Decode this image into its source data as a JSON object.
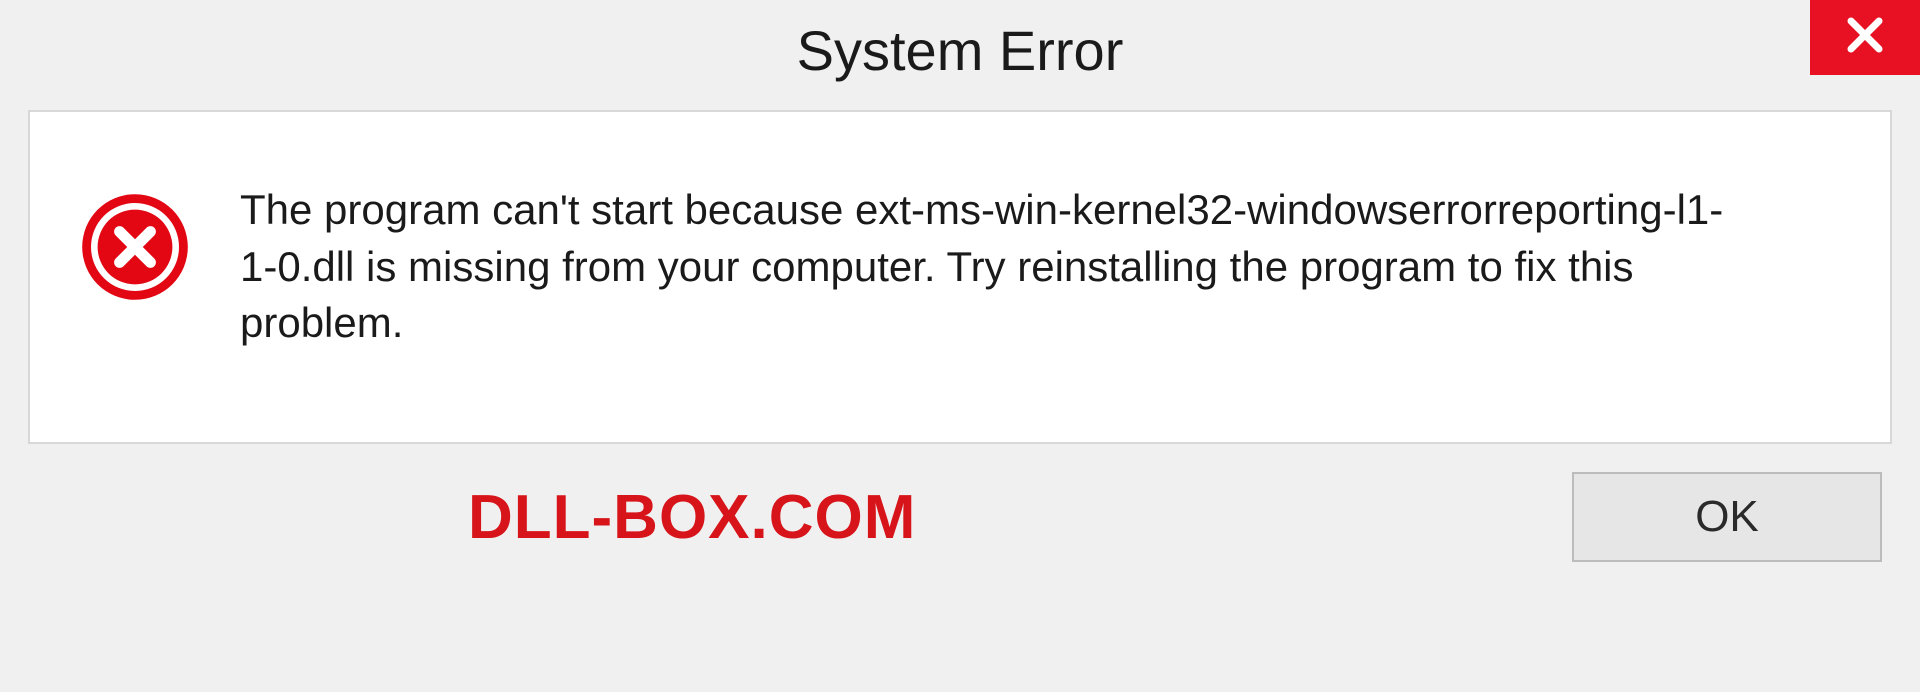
{
  "titlebar": {
    "title": "System Error"
  },
  "content": {
    "message": "The program can't start because ext-ms-win-kernel32-windowserrorreporting-l1-1-0.dll is missing from your computer. Try reinstalling the program to fix this problem."
  },
  "footer": {
    "watermark": "DLL-BOX.COM",
    "ok_label": "OK"
  },
  "colors": {
    "close_bg": "#e81123",
    "error_icon": "#e30613",
    "watermark": "#d6141a"
  }
}
